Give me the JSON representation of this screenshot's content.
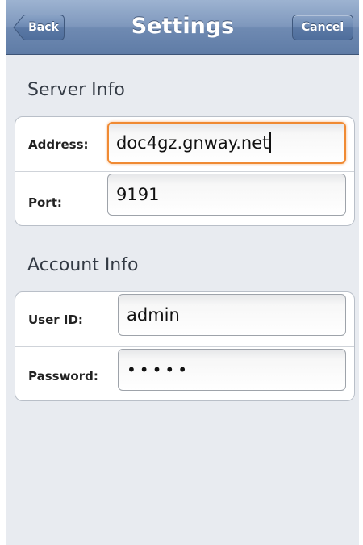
{
  "nav": {
    "title": "Settings",
    "back_label": "Back",
    "cancel_label": "Cancel"
  },
  "server_info": {
    "heading": "Server Info",
    "address": {
      "label": "Address:",
      "value": "doc4gz.gnway.net",
      "focused": true
    },
    "port": {
      "label": "Port:",
      "value": "9191"
    }
  },
  "account_info": {
    "heading": "Account Info",
    "user_id": {
      "label": "User ID:",
      "value": "admin"
    },
    "password": {
      "label": "Password:",
      "value": "•••••"
    }
  },
  "colors": {
    "navbar": "#7f98bd",
    "background": "#e8ebf0",
    "focus_ring": "#f08a33"
  }
}
